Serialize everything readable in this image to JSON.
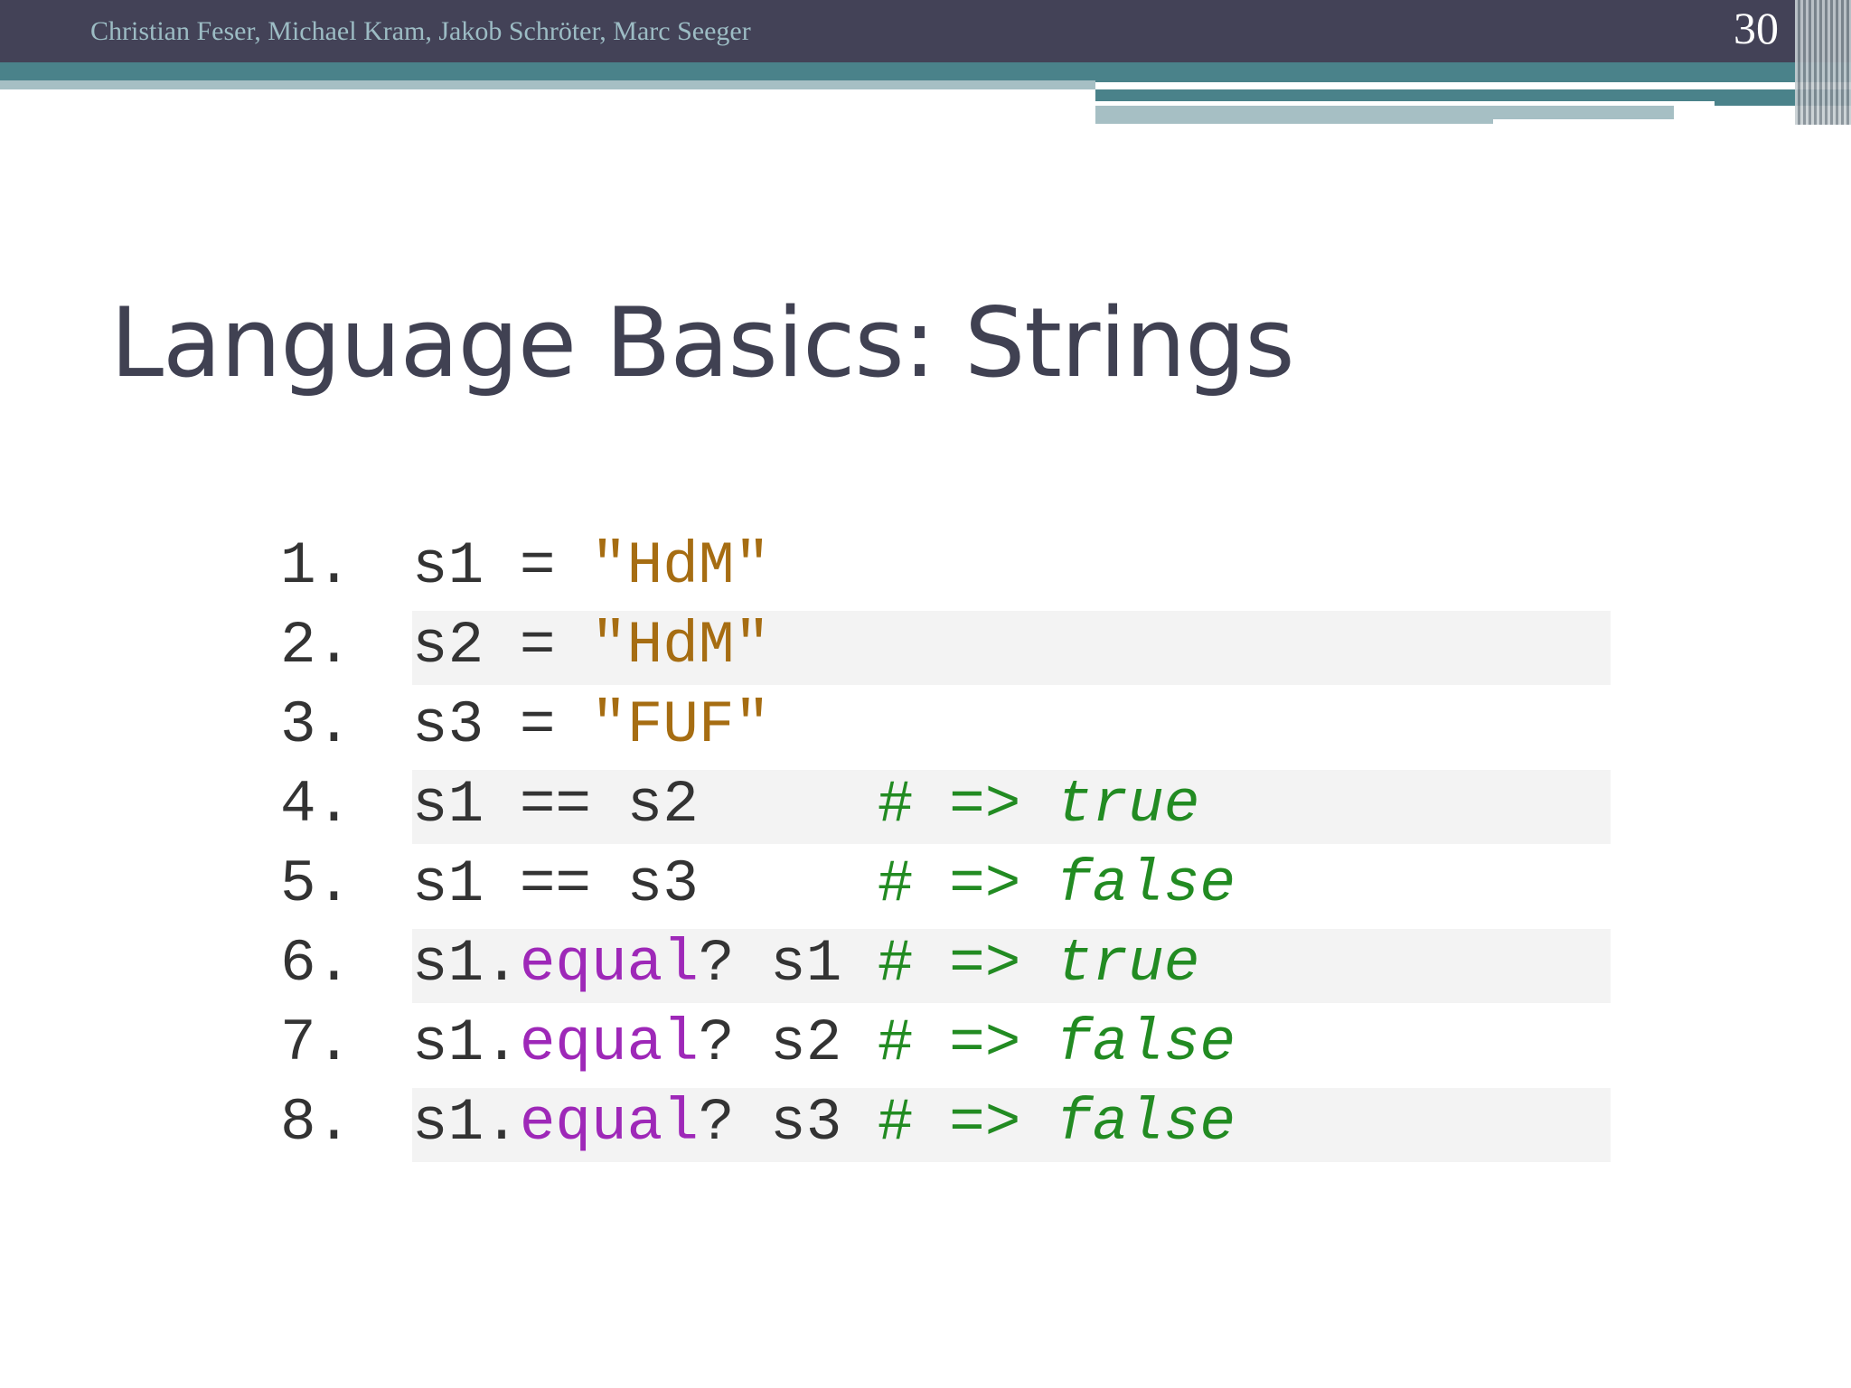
{
  "header": {
    "authors": "Christian Feser, Michael Kram, Jakob Schröter, Marc Seeger",
    "slide_number": "30"
  },
  "title": "Language Basics: Strings",
  "code_lines": [
    {
      "num": "1.",
      "parts": [
        {
          "t": "s1 = ",
          "c": "plain"
        },
        {
          "t": "\"HdM\"",
          "c": "str"
        }
      ]
    },
    {
      "num": "2.",
      "parts": [
        {
          "t": "s2 = ",
          "c": "plain"
        },
        {
          "t": "\"HdM\"",
          "c": "str"
        }
      ]
    },
    {
      "num": "3.",
      "parts": [
        {
          "t": "s3 = ",
          "c": "plain"
        },
        {
          "t": "\"FUF\"",
          "c": "str"
        }
      ]
    },
    {
      "num": "4.",
      "parts": [
        {
          "t": "s1 == s2     ",
          "c": "plain"
        },
        {
          "t": "# => ",
          "c": "cmt"
        },
        {
          "t": "true",
          "c": "cmtkw"
        }
      ]
    },
    {
      "num": "5.",
      "parts": [
        {
          "t": "s1 == s3     ",
          "c": "plain"
        },
        {
          "t": "# => ",
          "c": "cmt"
        },
        {
          "t": "false",
          "c": "cmtkw"
        }
      ]
    },
    {
      "num": "6.",
      "parts": [
        {
          "t": "s1.",
          "c": "plain"
        },
        {
          "t": "equal",
          "c": "method"
        },
        {
          "t": "? s1 ",
          "c": "plain"
        },
        {
          "t": "# => ",
          "c": "cmt"
        },
        {
          "t": "true",
          "c": "cmtkw"
        }
      ]
    },
    {
      "num": "7.",
      "parts": [
        {
          "t": "s1.",
          "c": "plain"
        },
        {
          "t": "equal",
          "c": "method"
        },
        {
          "t": "? s2 ",
          "c": "plain"
        },
        {
          "t": "# => ",
          "c": "cmt"
        },
        {
          "t": "false",
          "c": "cmtkw"
        }
      ]
    },
    {
      "num": "8.",
      "parts": [
        {
          "t": "s1.",
          "c": "plain"
        },
        {
          "t": "equal",
          "c": "method"
        },
        {
          "t": "? s3 ",
          "c": "plain"
        },
        {
          "t": "# => ",
          "c": "cmt"
        },
        {
          "t": "false",
          "c": "cmtkw"
        }
      ]
    }
  ]
}
